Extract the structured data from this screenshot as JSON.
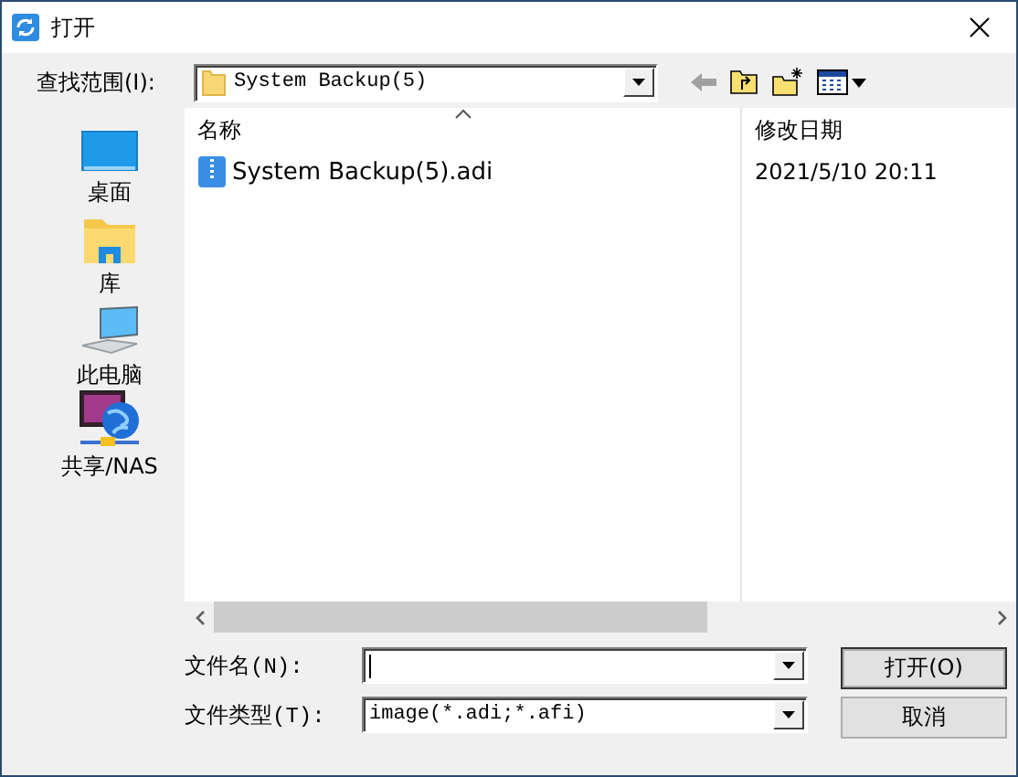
{
  "window": {
    "title": "打开"
  },
  "look_in": {
    "label": "查找范围(I):",
    "value": "System Backup(5)"
  },
  "places": [
    {
      "label": "桌面",
      "kind": "desktop"
    },
    {
      "label": "库",
      "kind": "library"
    },
    {
      "label": "此电脑",
      "kind": "computer"
    },
    {
      "label": "共享/NAS",
      "kind": "network"
    }
  ],
  "file_list": {
    "columns": [
      "名称",
      "修改日期"
    ],
    "rows": [
      {
        "name": "System Backup(5).adi",
        "modified": "2021/5/10 20:11"
      }
    ]
  },
  "file_name": {
    "label": "文件名(N):"
  },
  "file_type": {
    "label": "文件类型(T):",
    "value": "image(*.adi;*.afi)"
  },
  "buttons": [
    "打开(O)",
    "取消"
  ]
}
